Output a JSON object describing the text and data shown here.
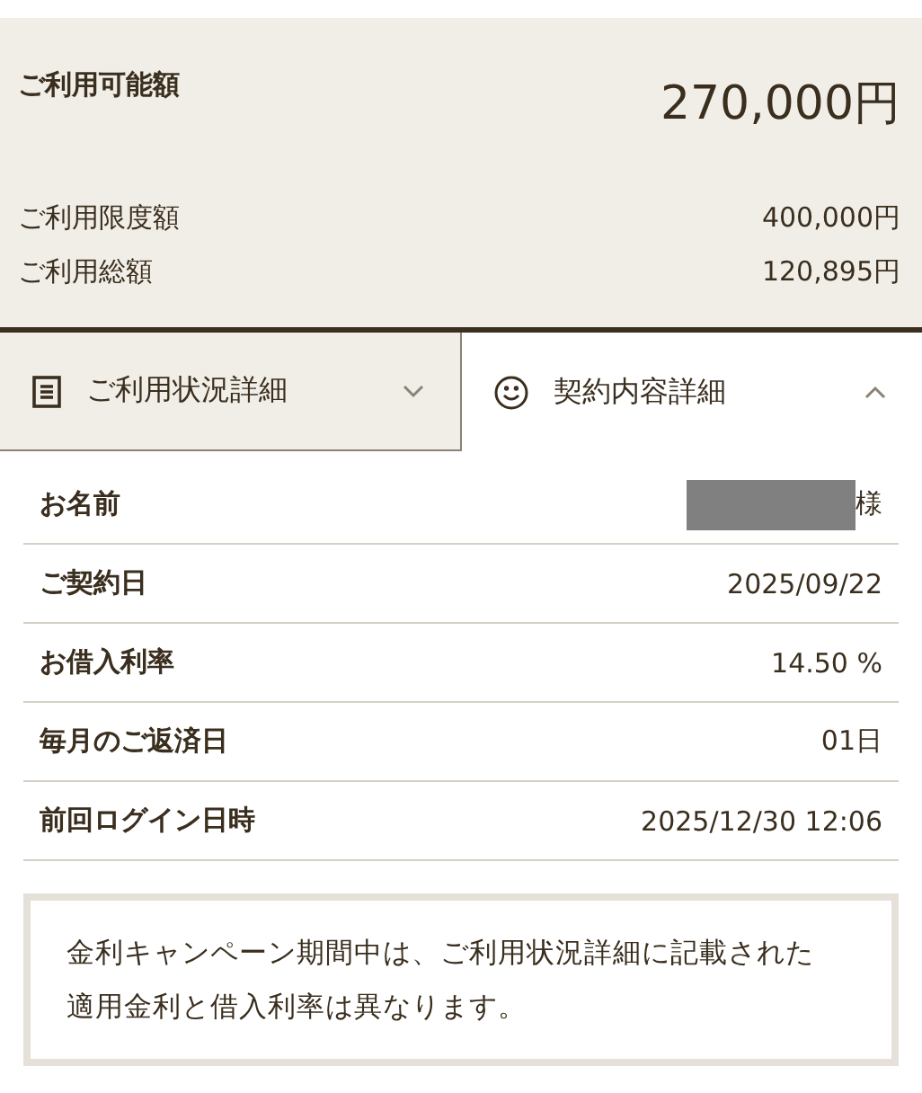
{
  "summary": {
    "available": {
      "label": "ご利用可能額",
      "value": "270,000円"
    },
    "lines": [
      {
        "label": "ご利用限度額",
        "value": "400,000円"
      },
      {
        "label": "ご利用総額",
        "value": "120,895円"
      }
    ]
  },
  "tabs": [
    {
      "kind": "document",
      "label": "ご利用状況詳細",
      "selected": false,
      "expanded": false
    },
    {
      "kind": "smile",
      "label": "契約内容詳細",
      "selected": true,
      "expanded": true
    }
  ],
  "details": [
    {
      "label": "お名前",
      "value": "様",
      "redacted": true
    },
    {
      "label": "ご契約日",
      "value": "2025/09/22",
      "redacted": false
    },
    {
      "label": "お借入利率",
      "value": "14.50 %",
      "redacted": false
    },
    {
      "label": "毎月のご返済日",
      "value": "01日",
      "redacted": false
    },
    {
      "label": "前回ログイン日時",
      "value": "2025/12/30 12:06",
      "redacted": false
    }
  ],
  "note": "金利キャンペーン期間中は、ご利用状況詳細に記載された適用金利と借入利率は異なります。"
}
